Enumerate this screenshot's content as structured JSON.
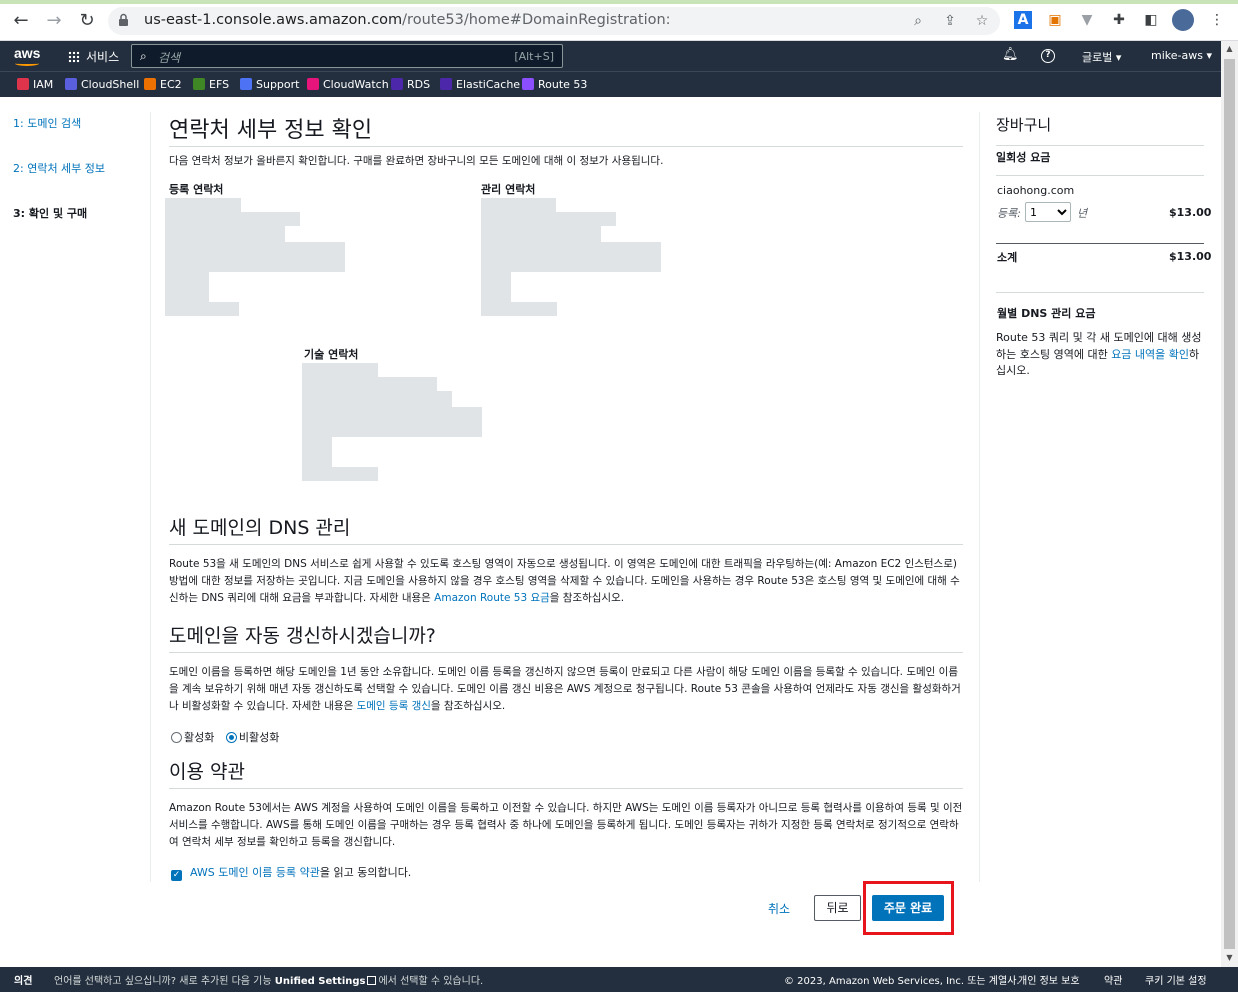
{
  "browser": {
    "url_host": "us-east-1.console.aws.amazon.com",
    "url_path": "/route53/home#DomainRegistration:"
  },
  "aws_header": {
    "services_label": "서비스",
    "search_placeholder": "검색",
    "search_shortcut": "[Alt+S]",
    "region": "글로벌 ▾",
    "account": "mike-aws ▾"
  },
  "favorites": [
    {
      "label": "IAM",
      "color": "#dd344c"
    },
    {
      "label": "CloudShell",
      "color": "#5a5fe0"
    },
    {
      "label": "EC2",
      "color": "#ed7100"
    },
    {
      "label": "EFS",
      "color": "#3f8624"
    },
    {
      "label": "Support",
      "color": "#4d72f3"
    },
    {
      "label": "CloudWatch",
      "color": "#e7157b"
    },
    {
      "label": "RDS",
      "color": "#4d27aa"
    },
    {
      "label": "ElastiCache",
      "color": "#4d27aa"
    },
    {
      "label": "Route 53",
      "color": "#8c4fff"
    }
  ],
  "steps": [
    {
      "label": "1: 도메인 검색"
    },
    {
      "label": "2: 연락처 세부 정보"
    },
    {
      "label": "3: 확인 및 구매"
    }
  ],
  "main": {
    "title": "연락처 세부 정보 확인",
    "intro": "다음 연락처 정보가 올바른지 확인합니다. 구매를 완료하면 장바구니의 모든 도메인에 대해 이 정보가 사용됩니다.",
    "registrant_title": "등록 연락처",
    "admin_title": "관리 연락처",
    "tech_title": "기술 연락처",
    "dns_title": "새 도메인의 DNS 관리",
    "dns_text": "Route 53을 새 도메인의 DNS 서비스로 쉽게 사용할 수 있도록 호스팅 영역이 자동으로 생성됩니다. 이 영역은 도메인에 대한 트래픽을 라우팅하는(예: Amazon EC2 인스턴스로) 방법에 대한 정보를 저장하는 곳입니다. 지금 도메인을 사용하지 않을 경우 호스팅 영역을 삭제할 수 있습니다. 도메인을 사용하는 경우 Route 53은 호스팅 영역 및 도메인에 대해 수신하는 DNS 쿼리에 대해 요금을 부과합니다. 자세한 내용은 ",
    "dns_link": "Amazon Route 53 요금",
    "dns_tail": "을 참조하십시오.",
    "renew_title": "도메인을 자동 갱신하시겠습니까?",
    "renew_text": "도메인 이름을 등록하면 해당 도메인을 1년 동안 소유합니다. 도메인 이름 등록을 갱신하지 않으면 등록이 만료되고 다른 사람이 해당 도메인 이름을 등록할 수 있습니다. 도메인 이름을 계속 보유하기 위해 매년 자동 갱신하도록 선택할 수 있습니다. 도메인 이름 갱신 비용은 AWS 계정으로 청구됩니다. Route 53 콘솔을 사용하여 언제라도 자동 갱신을 활성화하거나 비활성화할 수 있습니다. 자세한 내용은 ",
    "renew_link": "도메인 등록 갱신",
    "renew_tail": "을 참조하십시오.",
    "radio_enable": "활성화",
    "radio_disable": "비활성화",
    "terms_title": "이용 약관",
    "terms_text": "Amazon Route 53에서는 AWS 계정을 사용하여 도메인 이름을 등록하고 이전할 수 있습니다. 하지만 AWS는 도메인 이름 등록자가 아니므로 등록 협력사를 이용하여 등록 및 이전 서비스를 수행합니다. AWS를 통해 도메인 이름을 구매하는 경우 등록 협력사 중 하나에 도메인을 등록하게 됩니다. 도메인 등록자는 귀하가 지정한 등록 연락처로 정기적으로 연락하여 연락처 세부 정보를 확인하고 등록을 갱신합니다.",
    "agree_link": "AWS 도메인 이름 등록 약관",
    "agree_tail": "을 읽고 동의합니다.",
    "cancel": "취소",
    "back": "뒤로",
    "complete": "주문 완료"
  },
  "cart": {
    "title": "장바구니",
    "onetime_label": "일회성 요금",
    "domain": "ciaohong.com",
    "reg_label": "등록:",
    "years_value": "1",
    "years_unit": "년",
    "price": "$13.00",
    "subtotal_label": "소계",
    "subtotal": "$13.00",
    "monthly_label": "월별 DNS 관리 요금",
    "monthly_text": "Route 53 쿼리 및 각 새 도메인에 대해 생성하는 호스팅 영역에 대한 ",
    "monthly_link": "요금 내역을 확인",
    "monthly_tail": "하십시오."
  },
  "footer": {
    "feedback": "의견",
    "lang_text": "언어를 선택하고 싶으십니까? 새로 추가된 다음 기능",
    "unified": "Unified Settings",
    "lang_tail": "에서 선택할 수 있습니다.",
    "copyright": "© 2023, Amazon Web Services, Inc. 또는 계열사.",
    "privacy": "개인 정보 보호",
    "terms": "약관",
    "cookies": "쿠키 기본 설정"
  }
}
